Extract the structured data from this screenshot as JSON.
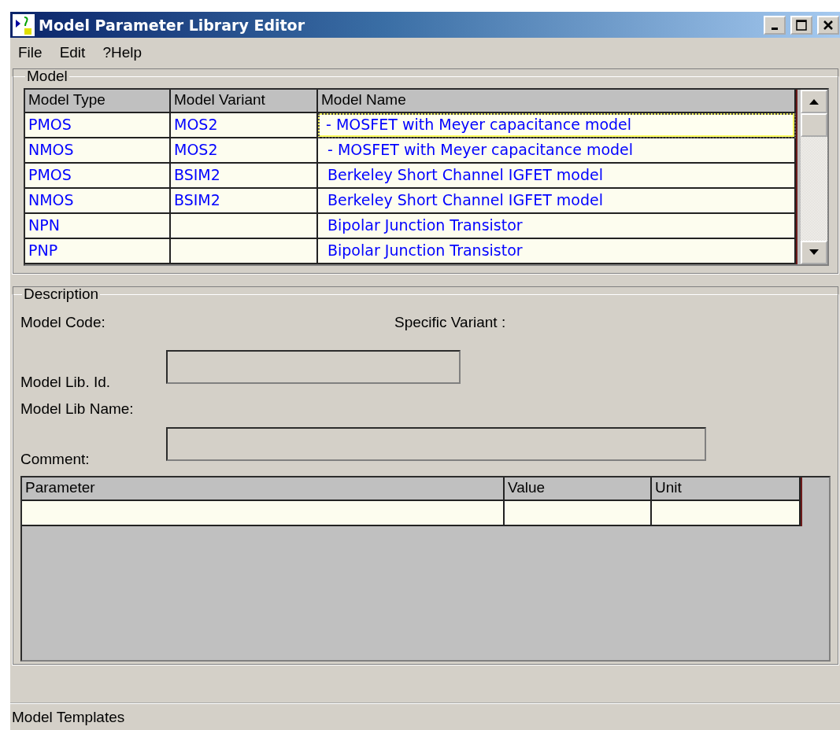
{
  "window": {
    "title": "Model Parameter Library Editor"
  },
  "menu": [
    "File",
    "Edit",
    "?Help"
  ],
  "model": {
    "title": "Model",
    "columns": [
      "Model Type",
      "Model Variant",
      "Model Name"
    ],
    "rows": [
      {
        "type": "PMOS",
        "variant": "MOS2",
        "name": "- MOSFET with Meyer capacitance model",
        "selected": true
      },
      {
        "type": "NMOS",
        "variant": "MOS2",
        "name": "- MOSFET with Meyer capacitance model",
        "selected": false
      },
      {
        "type": "PMOS",
        "variant": "BSIM2",
        "name": "Berkeley Short Channel IGFET model",
        "selected": false
      },
      {
        "type": "NMOS",
        "variant": "BSIM2",
        "name": "Berkeley Short Channel IGFET model",
        "selected": false
      },
      {
        "type": "NPN",
        "variant": "",
        "name": "Bipolar Junction Transistor",
        "selected": false
      },
      {
        "type": "PNP",
        "variant": "",
        "name": "Bipolar Junction Transistor",
        "selected": false
      }
    ]
  },
  "description": {
    "title": "Description",
    "model_code_label": "Model Code:",
    "specific_variant_label": "Specific Variant :",
    "lib_id_label": "Model Lib. Id.",
    "lib_name_label": "Model Lib Name:",
    "comment_label": "Comment:",
    "parameter_columns": [
      "Parameter",
      "Value",
      "Unit"
    ]
  },
  "status_bar": "Model Templates"
}
